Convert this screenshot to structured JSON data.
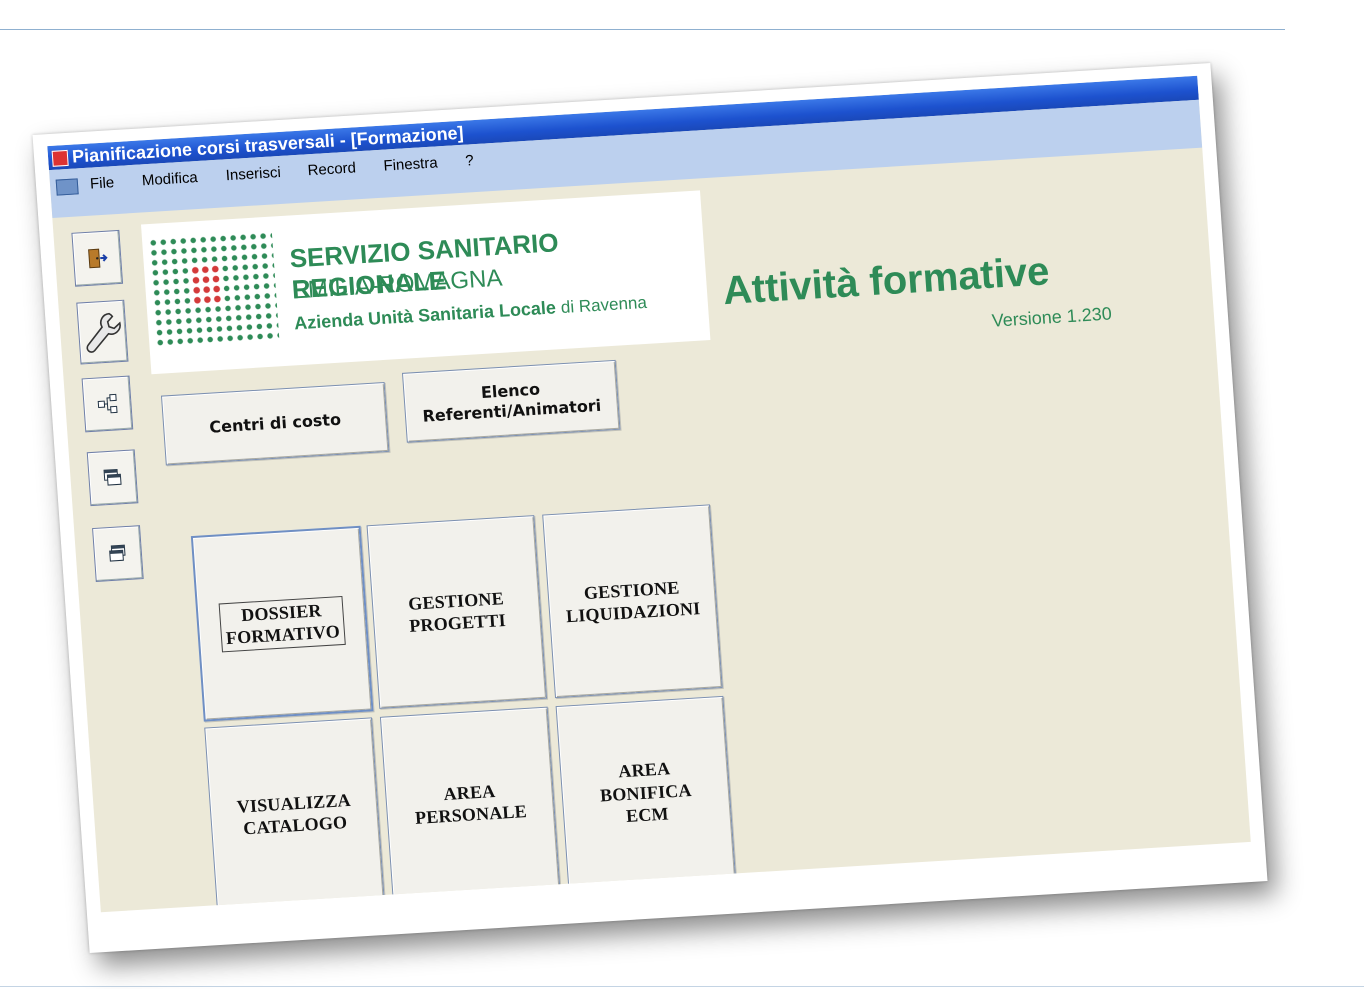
{
  "window": {
    "title": "Pianificazione corsi trasversali - [Formazione]"
  },
  "menu": [
    {
      "label": "File"
    },
    {
      "label": "Modifica"
    },
    {
      "label": "Inserisci"
    },
    {
      "label": "Record"
    },
    {
      "label": "Finestra"
    },
    {
      "label": "?"
    }
  ],
  "logo": {
    "line1": "SERVIZIO SANITARIO REGIONALE",
    "line2": "EMILIA-ROMAGNA",
    "line3_main": "Azienda Unità Sanitaria Locale",
    "line3_small": "di Ravenna"
  },
  "header": {
    "title": "Attività formative",
    "version": "Versione 1.230"
  },
  "toolbar": [
    {
      "icon": "exit-door-icon"
    },
    {
      "icon": "wrench-icon"
    },
    {
      "icon": "hierarchy-icon"
    },
    {
      "icon": "windows-icon"
    },
    {
      "icon": "windows-alt-icon"
    }
  ],
  "buttons": {
    "centri": "Centri di costo",
    "elenco_line1": "Elenco",
    "elenco_line2": "Referenti/Animatori"
  },
  "tiles": {
    "dossier_line1": "DOSSIER",
    "dossier_line2": "FORMATIVO",
    "progetti_line1": "GESTIONE",
    "progetti_line2": "PROGETTI",
    "liquidazioni_line1": "GESTIONE",
    "liquidazioni_line2": "LIQUIDAZIONI",
    "catalogo_line1": "VISUALIZZA",
    "catalogo_line2": "CATALOGO",
    "personale_line1": "AREA",
    "personale_line2": "PERSONALE",
    "bonifica_line1": "AREA",
    "bonifica_line2": "BONIFICA",
    "bonifica_line3": "ECM"
  },
  "colors": {
    "brand_green": "#2e8b57",
    "title_bar_blue": "#1d52cf",
    "form_background": "#ece9d8"
  }
}
